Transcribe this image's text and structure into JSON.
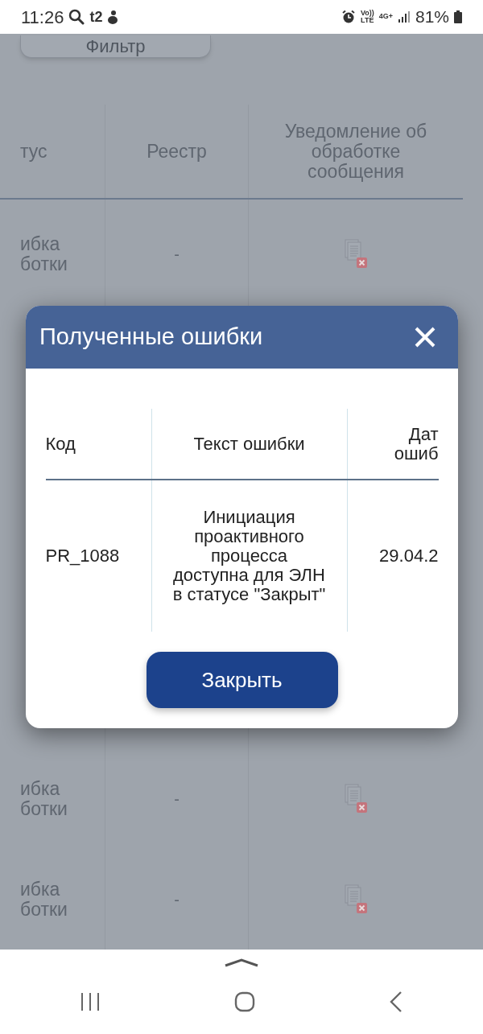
{
  "status_bar": {
    "time": "11:26",
    "carrier": "t2",
    "volte": [
      "Vo))",
      "LTE"
    ],
    "network": "4G+",
    "battery": "81%"
  },
  "filter_button": {
    "label": "Фильтр"
  },
  "table": {
    "columns": [
      "тус",
      "Реестр",
      "Уведомление об обработке сообщения"
    ],
    "rows": [
      {
        "status": "ибка\nботки",
        "registry": "-",
        "notification": {
          "kind": "error-document"
        }
      },
      {
        "status": "ибка\nботки",
        "registry": "-",
        "notification": {
          "kind": "error-document"
        }
      },
      {
        "status": "ибка\nботки",
        "registry": "-",
        "notification": {
          "kind": "error-document"
        }
      }
    ]
  },
  "dialog": {
    "title": "Полученные ошибки",
    "columns": [
      "Код",
      "Текст ошибки",
      "Дат\nошиб"
    ],
    "rows": [
      {
        "cells": [
          "PR_1088",
          "Инициация проактивного процесса доступна для ЭЛН в статусе \"Закрыт\"",
          "29.04.2"
        ]
      }
    ],
    "button": "Закрыть"
  }
}
